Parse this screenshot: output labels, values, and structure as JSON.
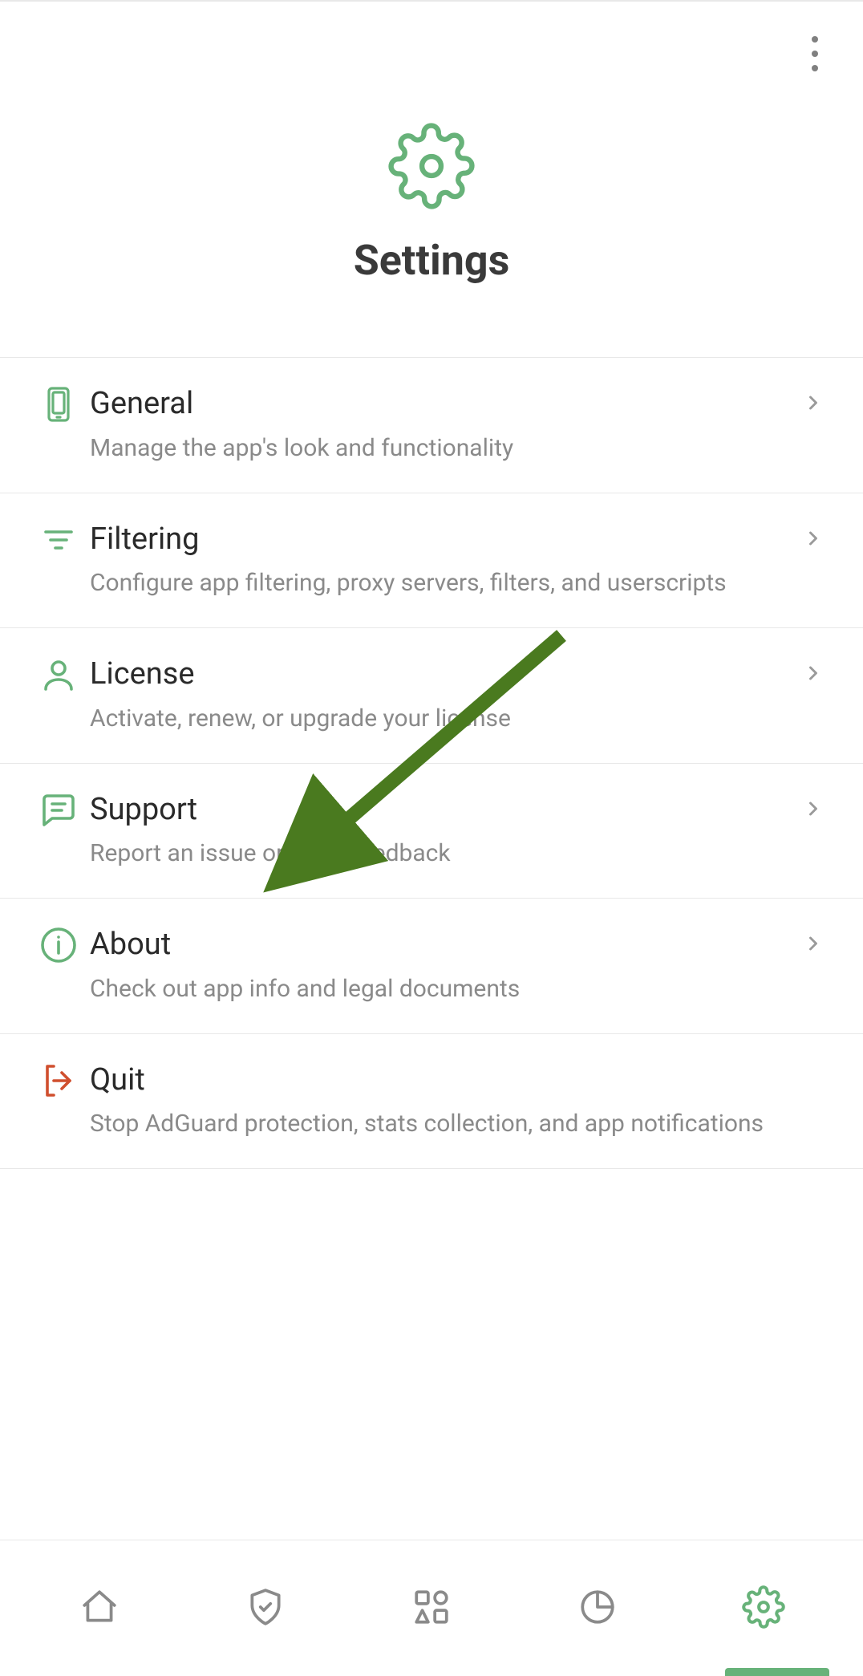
{
  "page": {
    "title": "Settings"
  },
  "items": [
    {
      "title": "General",
      "sub": "Manage the app's look and functionality"
    },
    {
      "title": "Filtering",
      "sub": "Configure app filtering, proxy servers, filters, and userscripts"
    },
    {
      "title": "License",
      "sub": "Activate, renew, or upgrade your license"
    },
    {
      "title": "Support",
      "sub": "Report an issue or leave feedback"
    },
    {
      "title": "About",
      "sub": "Check out app info and legal documents"
    },
    {
      "title": "Quit",
      "sub": "Stop AdGuard protection, stats collection, and app notifications"
    }
  ],
  "colors": {
    "accent": "#67b279",
    "danger": "#d04f2e",
    "muted": "#8a8a8a"
  }
}
